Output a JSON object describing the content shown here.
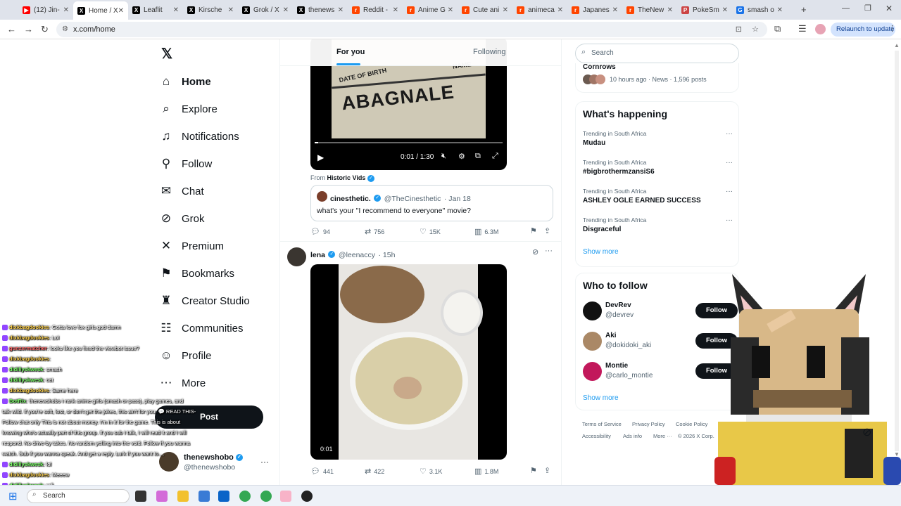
{
  "browser": {
    "tabs": [
      {
        "label": "(12) Jin-",
        "color": "#ff0000",
        "fav": "▶"
      },
      {
        "label": "Home / X",
        "color": "#000",
        "fav": "X"
      },
      {
        "label": "Leaflit",
        "color": "#000",
        "fav": "X"
      },
      {
        "label": "Kirsche",
        "color": "#000",
        "fav": "X"
      },
      {
        "label": "Grok / X",
        "color": "#000",
        "fav": "X"
      },
      {
        "label": "thenews",
        "color": "#000",
        "fav": "X"
      },
      {
        "label": "Reddit -",
        "color": "#ff4500",
        "fav": "r"
      },
      {
        "label": "Anime G",
        "color": "#ff4500",
        "fav": "r"
      },
      {
        "label": "Cute ani",
        "color": "#ff4500",
        "fav": "r"
      },
      {
        "label": "animeca",
        "color": "#ff4500",
        "fav": "r"
      },
      {
        "label": "Japanes",
        "color": "#ff4500",
        "fav": "r"
      },
      {
        "label": "TheNew",
        "color": "#ff4500",
        "fav": "r"
      },
      {
        "label": "PokeSm",
        "color": "#c44",
        "fav": "P"
      },
      {
        "label": "smash o",
        "color": "#1a73e8",
        "fav": "G"
      }
    ],
    "url": "x.com/home",
    "relaunch_label": "Relaunch to update"
  },
  "nav": {
    "items": [
      {
        "label": "Home",
        "icon": "home-icon",
        "glyph": "⌂"
      },
      {
        "label": "Explore",
        "icon": "search-icon",
        "glyph": "⌕"
      },
      {
        "label": "Notifications",
        "icon": "bell-icon",
        "glyph": "♫"
      },
      {
        "label": "Follow",
        "icon": "follow-icon",
        "glyph": "⚲"
      },
      {
        "label": "Chat",
        "icon": "mail-icon",
        "glyph": "✉"
      },
      {
        "label": "Grok",
        "icon": "grok-icon",
        "glyph": "⊘"
      },
      {
        "label": "Premium",
        "icon": "x-logo-icon",
        "glyph": "✕"
      },
      {
        "label": "Bookmarks",
        "icon": "bookmark-icon",
        "glyph": "⚑"
      },
      {
        "label": "Creator Studio",
        "icon": "creator-icon",
        "glyph": "♜"
      },
      {
        "label": "Communities",
        "icon": "communities-icon",
        "glyph": "☷"
      },
      {
        "label": "Profile",
        "icon": "profile-icon",
        "glyph": "☺"
      },
      {
        "label": "More",
        "icon": "more-icon",
        "glyph": "⋯"
      }
    ],
    "post_label": "Post",
    "account": {
      "name": "thenewshobo",
      "handle": "@thenewshobo"
    }
  },
  "feed": {
    "tab_for_you": "For you",
    "tab_following": "Following",
    "tweet1": {
      "video_time": "0:01 / 1:30",
      "from_label": "From",
      "from_source": "Historic Vids",
      "video_text_name": "NAME",
      "video_text_dob": "DATE OF BIRTH",
      "video_text_big": "ABAGNALE",
      "quote": {
        "name": "cinesthetic.",
        "handle": "@TheCinesthetic",
        "time": "· Jan 18",
        "text": "what's your \"I recommend to everyone\" movie?"
      },
      "replies": "94",
      "reposts": "756",
      "likes": "15K",
      "views": "6.3M"
    },
    "tweet2": {
      "name": "lena",
      "handle": "@leenaccy",
      "time": "· 15h",
      "video_time": "0:01",
      "replies": "441",
      "reposts": "422",
      "likes": "3.1K",
      "views": "1.8M"
    }
  },
  "sidebar": {
    "search_placeholder": "Search",
    "top_trend": {
      "title": "Cornrows",
      "meta": "10 hours ago · News · 1,596 posts"
    },
    "whats_happening_title": "What's happening",
    "trends": [
      {
        "context": "Trending in South Africa",
        "title": "Mudau"
      },
      {
        "context": "Trending in South Africa",
        "title": "#bigbrothermzansiS6"
      },
      {
        "context": "Trending in South Africa",
        "title": "ASHLEY OGLE EARNED SUCCESS"
      },
      {
        "context": "Trending in South Africa",
        "title": "Disgraceful"
      }
    ],
    "show_more": "Show more",
    "who_to_follow_title": "Who to follow",
    "follow_label": "Follow",
    "suggestions": [
      {
        "name": "DevRev",
        "handle": "@devrev",
        "color": "#111"
      },
      {
        "name": "Aki",
        "handle": "@dokidoki_aki",
        "color": "#a86"
      },
      {
        "name": "Montie",
        "handle": "@carlo_montie",
        "color": "#c2185b"
      }
    ],
    "footer": [
      "Terms of Service",
      "Privacy Policy",
      "Cookie Policy",
      "Accessibility",
      "Ads info",
      "More ···",
      "© 2026 X Corp."
    ]
  },
  "chat": [
    {
      "user": "dixkbagdookies",
      "msg": ": Gotta love fox girls god damn",
      "color": "#ffd24d"
    },
    {
      "user": "dixkbagdookies",
      "msg": ": Lol",
      "color": "#ffd24d"
    },
    {
      "user": "gunzermatcher",
      "msg": ": looks like you fixed the viewbot issue?",
      "color": "#ff6a6a"
    },
    {
      "user": "dixkbagdookies",
      "msg": ":",
      "color": "#ffd24d"
    },
    {
      "user": "didillyskwesk",
      "msg": ": smash",
      "color": "#7cff6a"
    },
    {
      "user": "didillyskwesk",
      "msg": ": cat",
      "color": "#7cff6a"
    },
    {
      "user": "dixkbagdookies",
      "msg": ": Same here",
      "color": "#ffd24d"
    },
    {
      "user": "BotRix",
      "msg": ": thenewshobo I rank anime girls (smash or pass), play games, and",
      "color": "#7cff6a"
    },
    {
      "user": "",
      "msg": "talk wild. If you're soft, lost, or don't get the jokes, this ain't for you. 💬 READ THIS-",
      "color": "#fff"
    },
    {
      "user": "",
      "msg": "Follow chat only This is not about money. I'm in it for the game. This is about",
      "color": "#fff"
    },
    {
      "user": "",
      "msg": "knowing who's actually part of this group. If you sub I talk, I will read it and I will",
      "color": "#fff"
    },
    {
      "user": "",
      "msg": "respond. No drive-by takes. No random yelling into the void. Follow if you wanna",
      "color": "#fff"
    },
    {
      "user": "",
      "msg": "watch. Sub if you wanna speak. And get a reply. Lurk if you want to....",
      "color": "#fff"
    },
    {
      "user": "didillyskwesk",
      "msg": ": lol",
      "color": "#7cff6a"
    },
    {
      "user": "dixkbagdookies",
      "msg": ": Meeew",
      "color": "#ffd24d"
    },
    {
      "user": "didillyskwesk",
      "msg": ": rofl",
      "color": "#7cff6a"
    }
  ],
  "taskbar": {
    "search_placeholder": "Search"
  }
}
